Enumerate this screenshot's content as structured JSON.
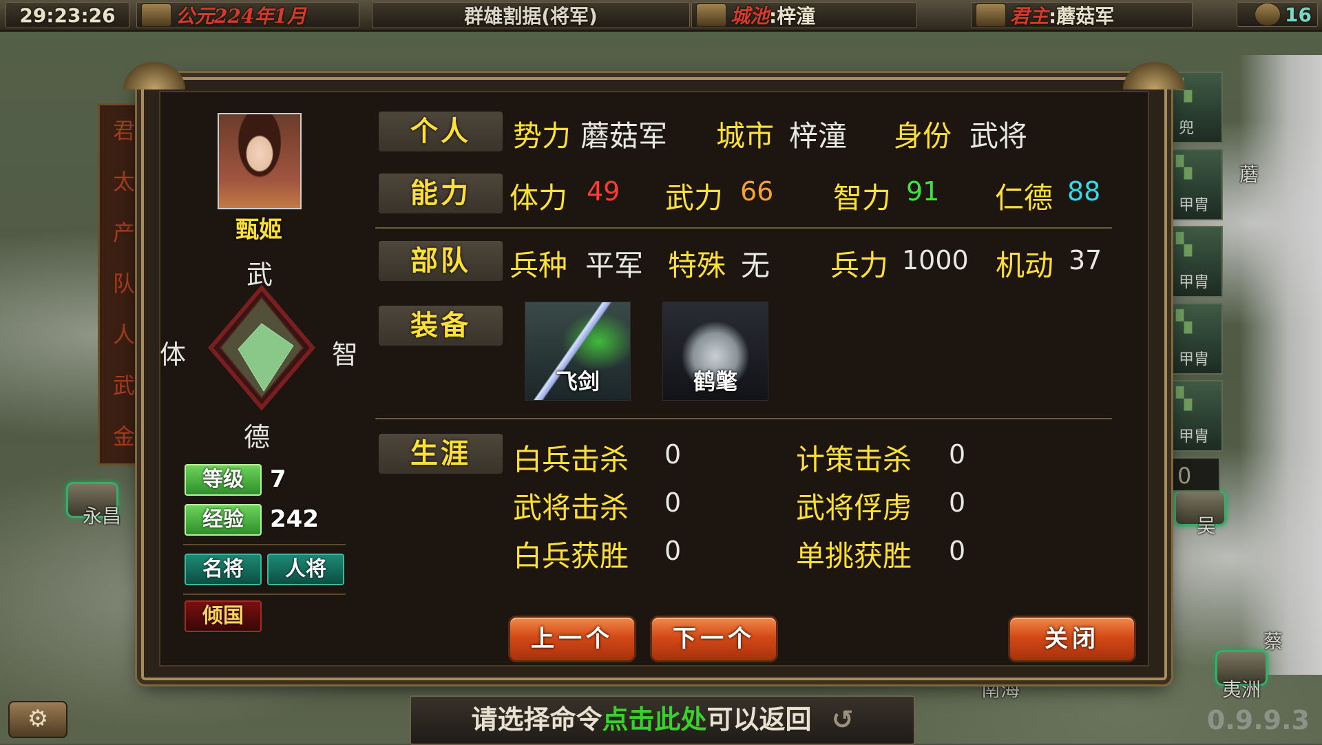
{
  "topbar": {
    "time": "29:23:26",
    "date": "公元224年1月",
    "scenario": "群雄割据(将军)",
    "city_label": "城池",
    "city_value": ":梓潼",
    "lord_label": "君主",
    "lord_value": ":蘑菇军",
    "coins": "16"
  },
  "map": {
    "labels": [
      "永昌",
      "南海",
      "吴",
      "夷洲",
      "蔡",
      "蘑",
      "兜"
    ]
  },
  "left_strip": [
    "君",
    "太",
    "产",
    "队",
    "人",
    "武",
    "金"
  ],
  "right_strip": {
    "items": [
      {
        "top": "",
        "bottom": "兜"
      },
      {
        "top": "",
        "bottom": "甲胄"
      },
      {
        "top": "",
        "bottom": "甲胄"
      },
      {
        "top": "",
        "bottom": "甲胄"
      },
      {
        "top": "",
        "bottom": "甲胄"
      }
    ],
    "count": "0"
  },
  "general": {
    "name": "甄姬",
    "radar": {
      "top": "武",
      "left": "体",
      "right": "智",
      "bottom": "德"
    },
    "level_label": "等级",
    "level": "7",
    "exp_label": "经验",
    "exp": "242",
    "traits": [
      "名将",
      "人将"
    ],
    "special": "倾国"
  },
  "sections": {
    "personal": {
      "title": "个人",
      "faction_label": "势力",
      "faction": "蘑菇军",
      "city_label": "城市",
      "city": "梓潼",
      "role_label": "身份",
      "role": "武将"
    },
    "ability": {
      "title": "能力",
      "stamina_label": "体力",
      "stamina": "49",
      "force_label": "武力",
      "force": "66",
      "intel_label": "智力",
      "intel": "91",
      "virtue_label": "仁德",
      "virtue": "88"
    },
    "troops": {
      "title": "部队",
      "type_label": "兵种",
      "type": "平军",
      "special_label": "特殊",
      "special": "无",
      "strength_label": "兵力",
      "strength": "1000",
      "mobility_label": "机动",
      "mobility": "37"
    },
    "equipment": {
      "title": "装备",
      "items": [
        {
          "name": "飞剑",
          "icon": "sword-icon"
        },
        {
          "name": "鹤氅",
          "icon": "robe-icon"
        }
      ]
    },
    "career": {
      "title": "生涯",
      "stats": [
        {
          "label": "白兵击杀",
          "value": "0"
        },
        {
          "label": "计策击杀",
          "value": "0"
        },
        {
          "label": "武将击杀",
          "value": "0"
        },
        {
          "label": "武将俘虏",
          "value": "0"
        },
        {
          "label": "白兵获胜",
          "value": "0"
        },
        {
          "label": "单挑获胜",
          "value": "0"
        }
      ]
    }
  },
  "buttons": {
    "prev": "上一个",
    "next": "下一个",
    "close": "关闭"
  },
  "bottom": {
    "cmd_prefix": "请选择命令",
    "cmd_link": "点击此处",
    "cmd_suffix": "可以返回",
    "return_icon": "↺",
    "version": "0.9.9.3",
    "settings_icon": "gear-icon"
  },
  "colors": {
    "label_yellow": "#ffe03a",
    "stamina_red": "#ff3b3b",
    "force_orange": "#f4a332",
    "intel_green": "#3ce63c",
    "virtue_cyan": "#37d8e8",
    "button_orange": "#d34a17"
  }
}
